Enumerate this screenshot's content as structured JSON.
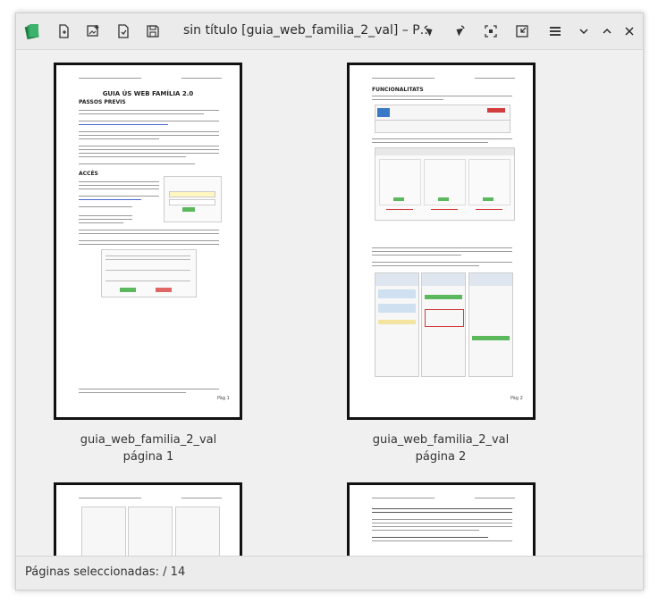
{
  "window": {
    "title": "sin título [guia_web_familia_2_val] – P…"
  },
  "pages": [
    {
      "file": "guia_web_familia_2_val",
      "label": "página 1",
      "heading": "GUIA ÚS WEB FAMÍLIA 2.0",
      "section": "PASSOS PREVIS",
      "section2": "ACCÉS",
      "footer": "Pàg 1"
    },
    {
      "file": "guia_web_familia_2_val",
      "label": "página 2",
      "heading": "FUNCIONALITATS",
      "footer": "Pàg 2"
    }
  ],
  "status": {
    "label": "Páginas seleccionadas:",
    "value": "/ 14"
  },
  "icons": [
    "app-logo-icon",
    "new-document-icon",
    "add-image-icon",
    "export-icon",
    "save-icon",
    "rotate-left-icon",
    "rotate-right-icon",
    "zoom-fit-icon",
    "zoom-reduce-icon",
    "menu-icon",
    "minimize-icon",
    "maximize-icon",
    "close-icon"
  ]
}
